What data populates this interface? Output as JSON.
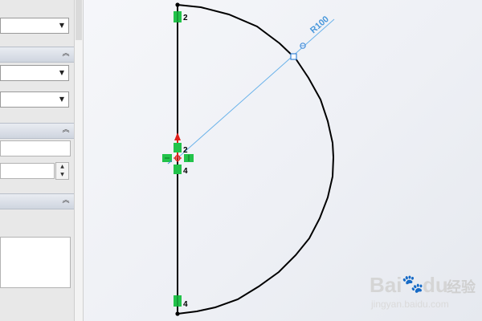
{
  "sketch": {
    "dimension_label": "R100",
    "relation_labels": {
      "top_endpoint": "2",
      "center_upper": "2",
      "center_lower": "4",
      "bottom_endpoint": "4"
    },
    "colors": {
      "sketch_line": "#000000",
      "dimension": "#4aa3e0",
      "relation_marker": "#22c34a",
      "origin_arrow": "#e0201b"
    }
  },
  "watermark": {
    "brand": "Bai",
    "paw": "🐾",
    "du": "du",
    "cn": "经验",
    "url": "jingyan.baidu.com"
  },
  "panel": {
    "scroll_up_icon": "▲"
  }
}
